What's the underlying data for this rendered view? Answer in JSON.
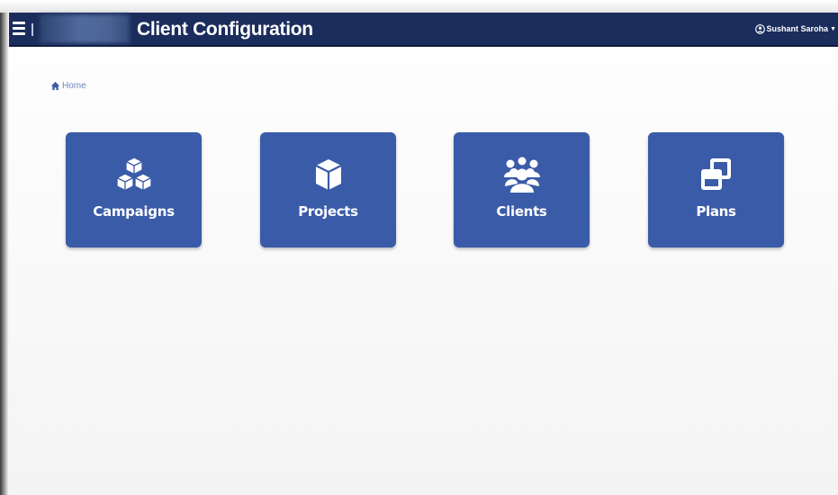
{
  "header": {
    "title": "Client Configuration",
    "user_name": "Sushant Saroha",
    "menu_icon": "hamburger-icon",
    "user_icon": "user-icon",
    "background_color": "#1b2d5c"
  },
  "breadcrumb": {
    "home_label": "Home",
    "home_icon": "home-icon",
    "color": "#6a86c4"
  },
  "tiles": [
    {
      "label": "Campaigns",
      "icon": "cubes-icon"
    },
    {
      "label": "Projects",
      "icon": "cube-icon"
    },
    {
      "label": "Clients",
      "icon": "users-icon"
    },
    {
      "label": "Plans",
      "icon": "clone-icon"
    }
  ],
  "tile_color": "#3a5ba8"
}
